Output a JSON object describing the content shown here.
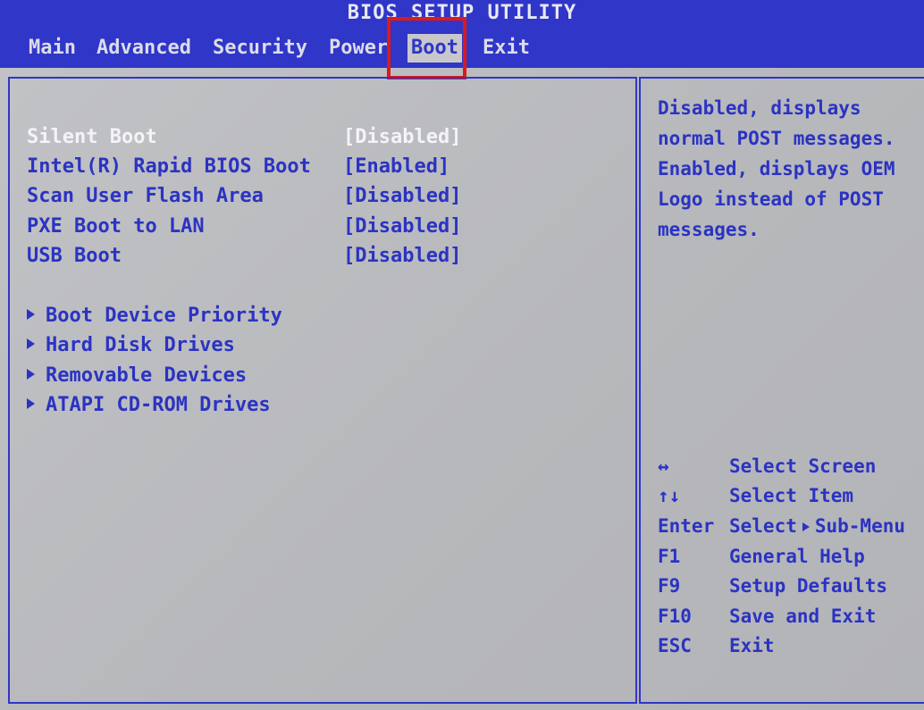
{
  "title": "BIOS SETUP UTILITY",
  "menu": [
    {
      "label": "Main"
    },
    {
      "label": "Advanced"
    },
    {
      "label": "Security"
    },
    {
      "label": "Power"
    },
    {
      "label": "Boot",
      "active": true
    },
    {
      "label": "Exit"
    }
  ],
  "options": [
    {
      "label": "Silent Boot",
      "value": "[Disabled]",
      "selected": true
    },
    {
      "label": "Intel(R) Rapid BIOS Boot",
      "value": "[Enabled]"
    },
    {
      "label": "Scan User Flash Area",
      "value": "[Disabled]"
    },
    {
      "label": "PXE Boot to LAN",
      "value": "[Disabled]"
    },
    {
      "label": "USB Boot",
      "value": "[Disabled]"
    }
  ],
  "submenus": [
    {
      "label": "Boot Device Priority"
    },
    {
      "label": "Hard Disk Drives"
    },
    {
      "label": "Removable Devices"
    },
    {
      "label": "ATAPI CD-ROM Drives"
    }
  ],
  "help": {
    "lines": [
      "Disabled, displays",
      "normal POST messages.",
      "Enabled, displays OEM",
      "Logo instead of POST",
      "messages."
    ]
  },
  "keys": [
    {
      "key": "↔",
      "desc": "Select Screen"
    },
    {
      "key": "↑↓",
      "desc": "Select Item"
    },
    {
      "key": "Enter",
      "desc_pre": "Select",
      "desc": "Sub-Menu"
    },
    {
      "key": "F1",
      "desc": "General Help"
    },
    {
      "key": "F9",
      "desc": "Setup Defaults"
    },
    {
      "key": "F10",
      "desc": "Save and Exit"
    },
    {
      "key": "ESC",
      "desc": "Exit"
    }
  ],
  "colors": {
    "bar_blue": "#2f36c8",
    "text_blue": "#2b33c2",
    "panel_gray": "#bcbcc0",
    "selected_text": "#f4f4f8",
    "highlight_red": "#e01818"
  }
}
